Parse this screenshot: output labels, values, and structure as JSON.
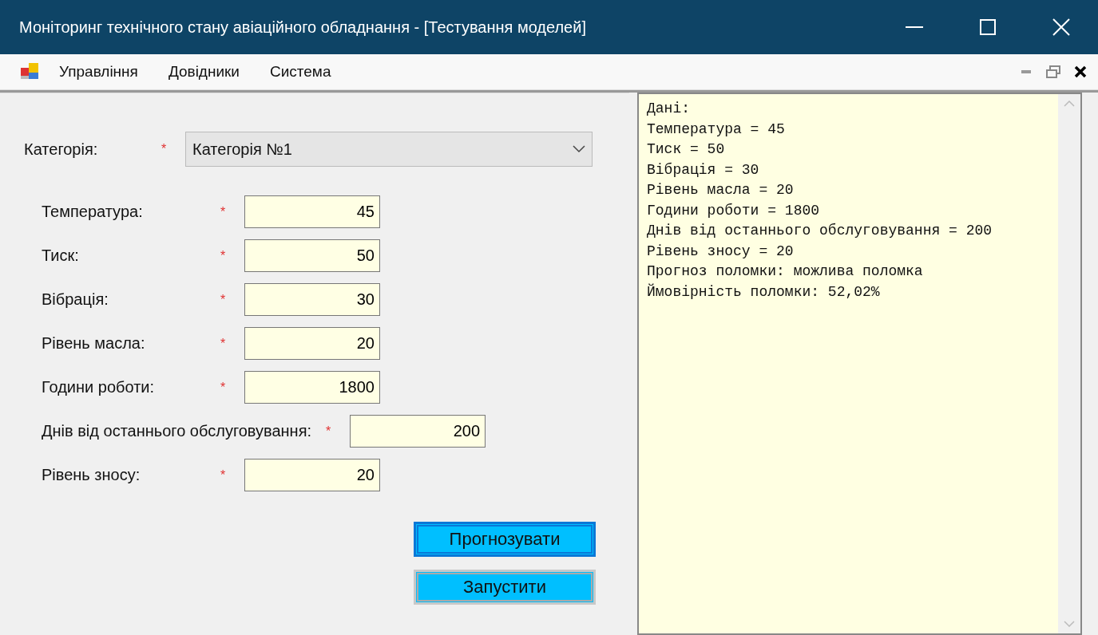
{
  "window": {
    "title": "Моніторинг технічного стану авіаційного обладнання - [Тестування моделей]"
  },
  "menu": [
    "Управління",
    "Довідники",
    "Система"
  ],
  "category": {
    "label": "Категорія:",
    "required": "*",
    "value": "Категорія №1"
  },
  "fields": [
    {
      "label": "Температура:",
      "required": "*",
      "value": "45"
    },
    {
      "label": "Тиск:",
      "required": "*",
      "value": "50"
    },
    {
      "label": "Вібрація:",
      "required": "*",
      "value": "30"
    },
    {
      "label": "Рівень масла:",
      "required": "*",
      "value": "20"
    },
    {
      "label": "Години роботи:",
      "required": "*",
      "value": "1800"
    },
    {
      "label": "Днів від останнього обслуговування:",
      "required": "*",
      "value": "200"
    },
    {
      "label": "Рівень зносу:",
      "required": "*",
      "value": "20"
    }
  ],
  "buttons": [
    {
      "label": "Прогнозувати",
      "focused": true
    },
    {
      "label": "Запустити",
      "focused": false
    }
  ],
  "output": [
    "Дані:",
    "Температура = 45",
    "Тиск = 50",
    "Вібрація = 30",
    "Рівень масла = 20",
    "Години роботи = 1800",
    "Днів від останнього обслуговування = 200",
    "Рівень зносу = 20",
    "Прогноз поломки: можлива поломка",
    "Ймовірність поломки: 52,02%"
  ]
}
